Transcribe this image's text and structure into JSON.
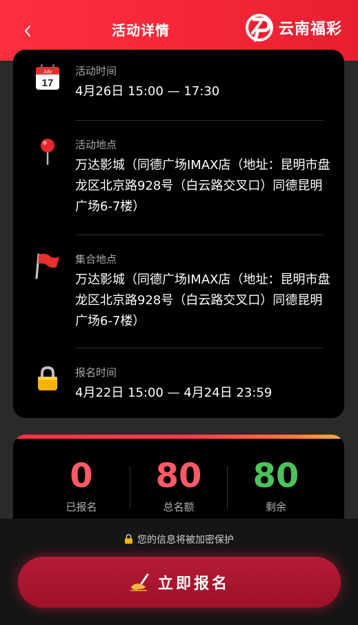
{
  "header": {
    "title": "活动详情",
    "brand": "云南福彩",
    "back_icon": "chevron-left-icon",
    "color": "#f22637"
  },
  "details": [
    {
      "icon": "calendar-icon",
      "calendar_month": "July",
      "calendar_day": "17",
      "label": "活动时间",
      "value": "4月26日 15:00 — 17:30"
    },
    {
      "icon": "map-pin-icon",
      "label": "活动地点",
      "value": "万达影城（同德广场IMAX店（地址：昆明市盘龙区北京路928号（白云路交叉口）同德昆明广场6-7楼）"
    },
    {
      "icon": "flag-icon",
      "label": "集合地点",
      "value": "万达影城（同德广场IMAX店（地址：昆明市盘龙区北京路928号（白云路交叉口）同德昆明广场6-7楼）"
    },
    {
      "icon": "lock-icon",
      "label": "报名时间",
      "value": "4月22日 15:00 — 4月24日 23:59"
    }
  ],
  "stats": [
    {
      "value": "0",
      "label": "已报名",
      "color": "#ff5a66"
    },
    {
      "value": "80",
      "label": "总名额",
      "color": "#ff5a66"
    },
    {
      "value": "80",
      "label": "剩余",
      "color": "#4cc35a"
    }
  ],
  "privacy_text": "您的信息将被加密保护",
  "signup_button": "立即报名"
}
